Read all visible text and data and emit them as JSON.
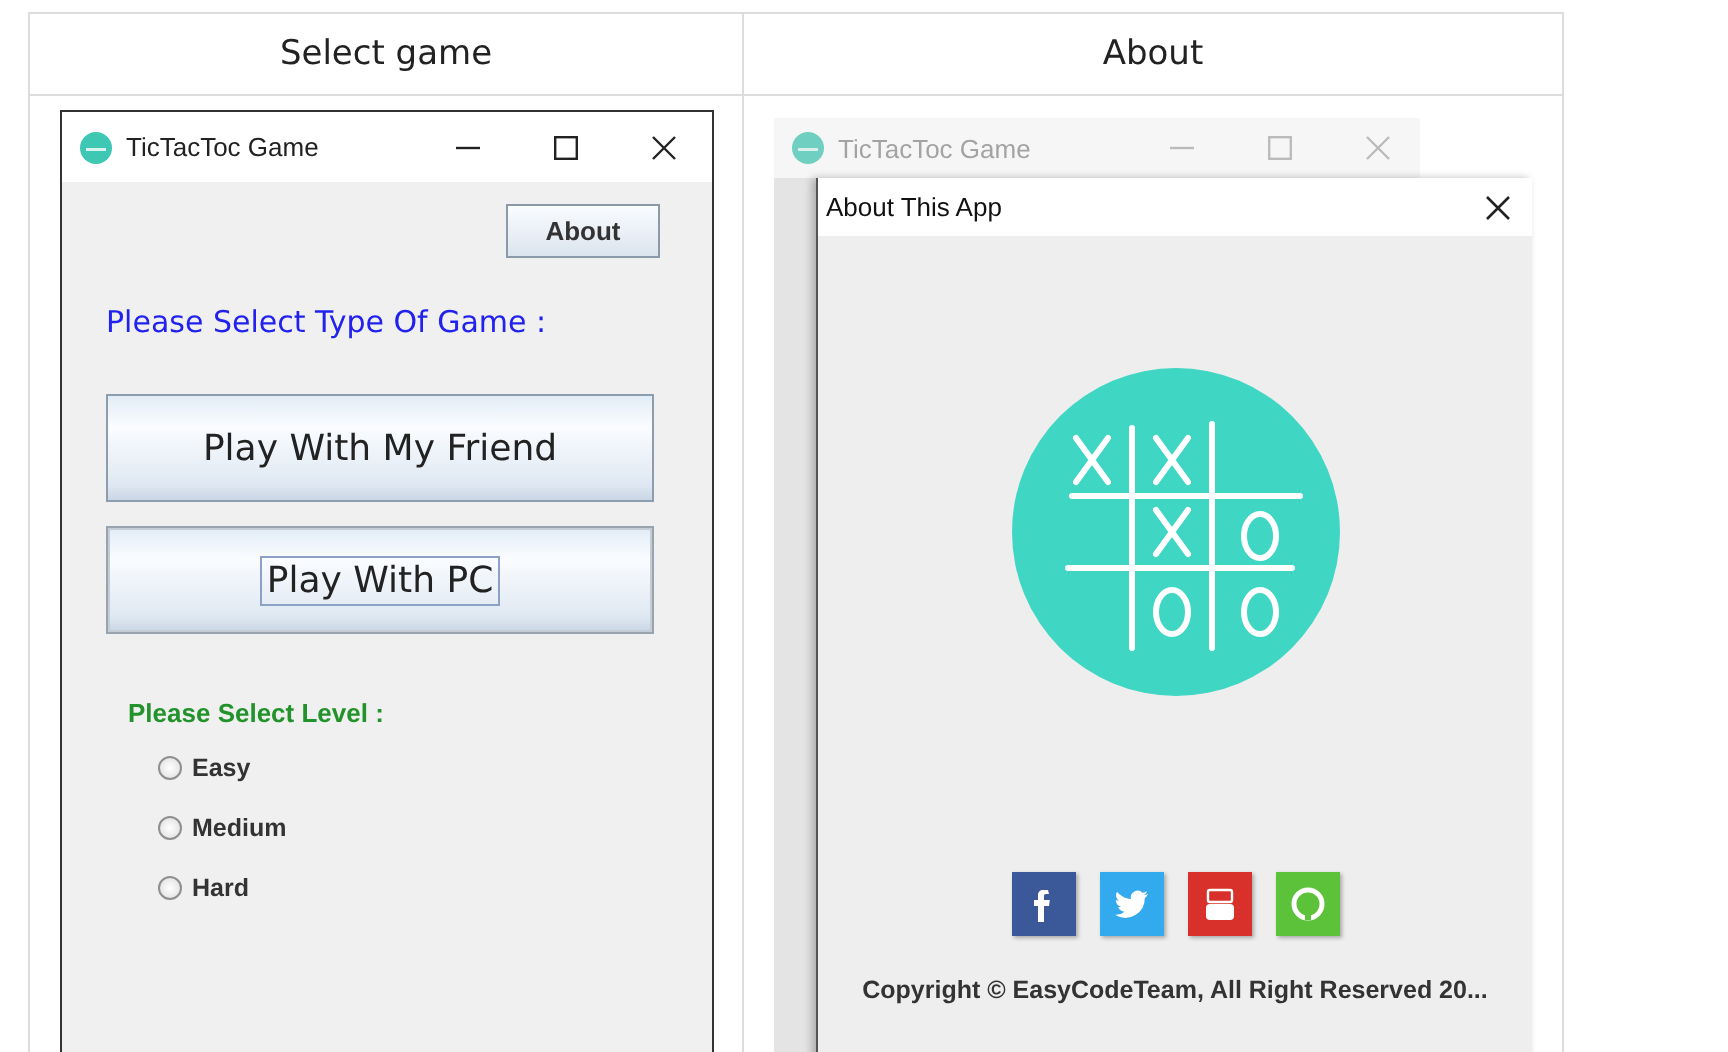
{
  "table": {
    "columns": [
      "Select game",
      "About"
    ]
  },
  "main_window": {
    "title": "TicTacToc Game",
    "about_button": "About",
    "prompt": "Please Select Type Of Game :",
    "game_buttons": [
      {
        "label": "Play With My Friend",
        "focused": false
      },
      {
        "label": "Play With PC",
        "focused": true
      }
    ],
    "level_prompt": "Please Select Level :",
    "levels": [
      {
        "label": "Easy",
        "selected": false
      },
      {
        "label": "Medium",
        "selected": false
      },
      {
        "label": "Hard",
        "selected": false
      }
    ]
  },
  "background_window": {
    "title": "TicTacToc Game"
  },
  "about_dialog": {
    "title": "About This App",
    "social_links": [
      {
        "kind": "facebook"
      },
      {
        "kind": "twitter"
      },
      {
        "kind": "youtube"
      },
      {
        "kind": "github"
      }
    ],
    "copyright": "Copyright © EasyCodeTeam, All Right Reserved 20..."
  }
}
